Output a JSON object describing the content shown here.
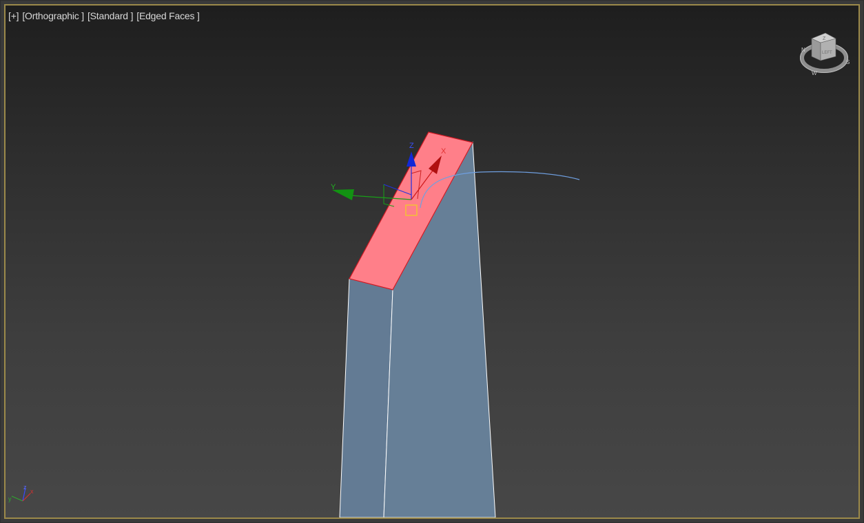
{
  "viewport": {
    "labels": {
      "plus": "[+]",
      "view": "[Orthographic ]",
      "shading": "[Standard ]",
      "edges": "[Edged Faces ]"
    }
  },
  "gizmo": {
    "axis_x": "X",
    "axis_y": "Y",
    "axis_z": "Z"
  },
  "viewcube": {
    "cube_face_label": "LEFT",
    "cube_top_label": "Z",
    "compass_labels": [
      "N",
      "S",
      "W"
    ]
  },
  "tripod": {
    "x": "x",
    "y": "y",
    "z": "z"
  },
  "colors": {
    "selected_face": "#ff7f89",
    "box_sides": "#647d96",
    "frame_border": "#9c8a4a",
    "gizmo_x": "#c01414",
    "gizmo_y": "#129212",
    "gizmo_z": "#1228d8",
    "spline": "#6f9fe0"
  },
  "icons": [
    "move-gizmo-icon",
    "viewcube-icon",
    "axis-tripod-icon",
    "pivot-marker-icon"
  ]
}
